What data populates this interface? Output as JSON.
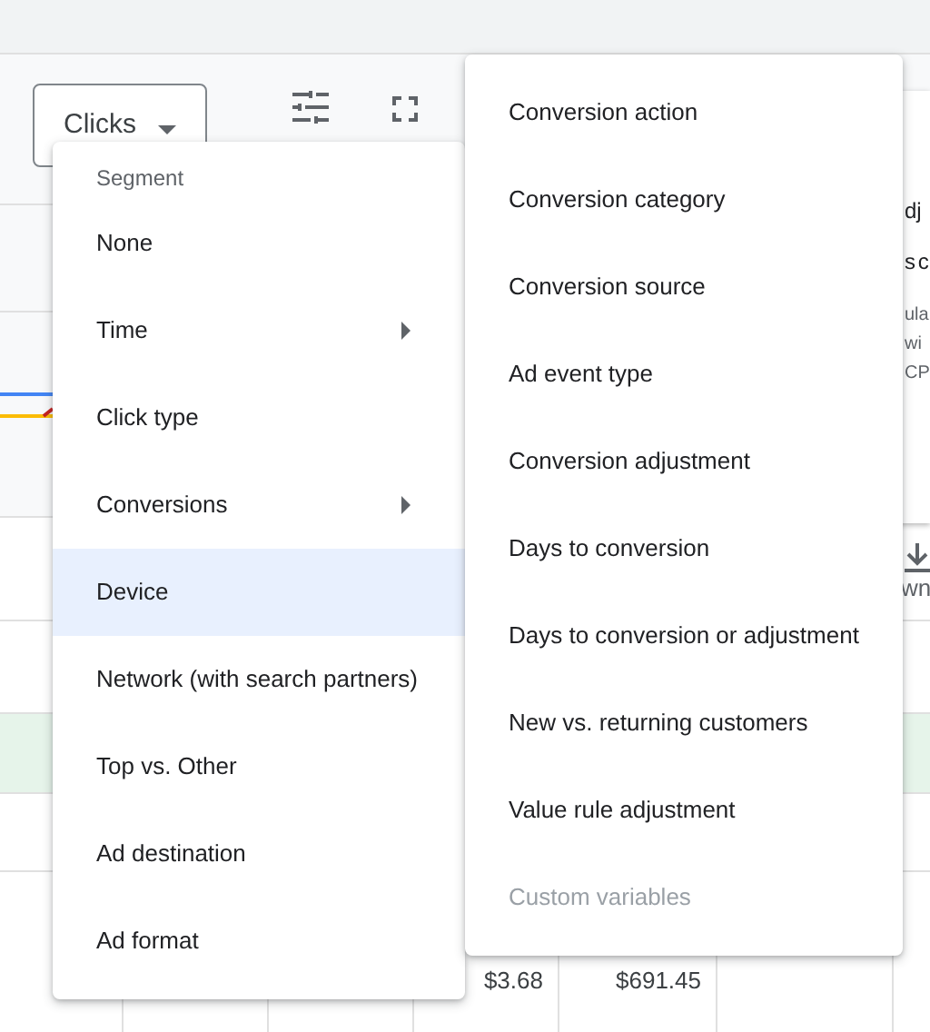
{
  "toolbar": {
    "metric_dropdown": "Clicks"
  },
  "side_card": {
    "lines": [
      "dj",
      "s c",
      "ula",
      "wi",
      "CP"
    ]
  },
  "download_label": "wn",
  "table": {
    "cells": [
      "$3.68",
      "$691.45"
    ]
  },
  "segment_menu": {
    "header": "Segment",
    "items": [
      {
        "label": "None",
        "submenu": false,
        "selected": false
      },
      {
        "label": "Time",
        "submenu": true,
        "selected": false
      },
      {
        "label": "Click type",
        "submenu": false,
        "selected": false
      },
      {
        "label": "Conversions",
        "submenu": true,
        "selected": false
      },
      {
        "label": "Device",
        "submenu": false,
        "selected": true
      },
      {
        "label": "Network (with search partners)",
        "submenu": false,
        "selected": false
      },
      {
        "label": "Top vs. Other",
        "submenu": false,
        "selected": false
      },
      {
        "label": "Ad destination",
        "submenu": false,
        "selected": false
      },
      {
        "label": "Ad format",
        "submenu": false,
        "selected": false
      }
    ]
  },
  "conversions_submenu": {
    "items": [
      {
        "label": "Conversion action",
        "disabled": false
      },
      {
        "label": "Conversion category",
        "disabled": false
      },
      {
        "label": "Conversion source",
        "disabled": false
      },
      {
        "label": "Ad event type",
        "disabled": false
      },
      {
        "label": "Conversion adjustment",
        "disabled": false
      },
      {
        "label": "Days to conversion",
        "disabled": false
      },
      {
        "label": "Days to conversion or adjustment",
        "disabled": false
      },
      {
        "label": "New vs. returning customers",
        "disabled": false
      },
      {
        "label": "Value rule adjustment",
        "disabled": false
      },
      {
        "label": "Custom variables",
        "disabled": true
      }
    ]
  }
}
